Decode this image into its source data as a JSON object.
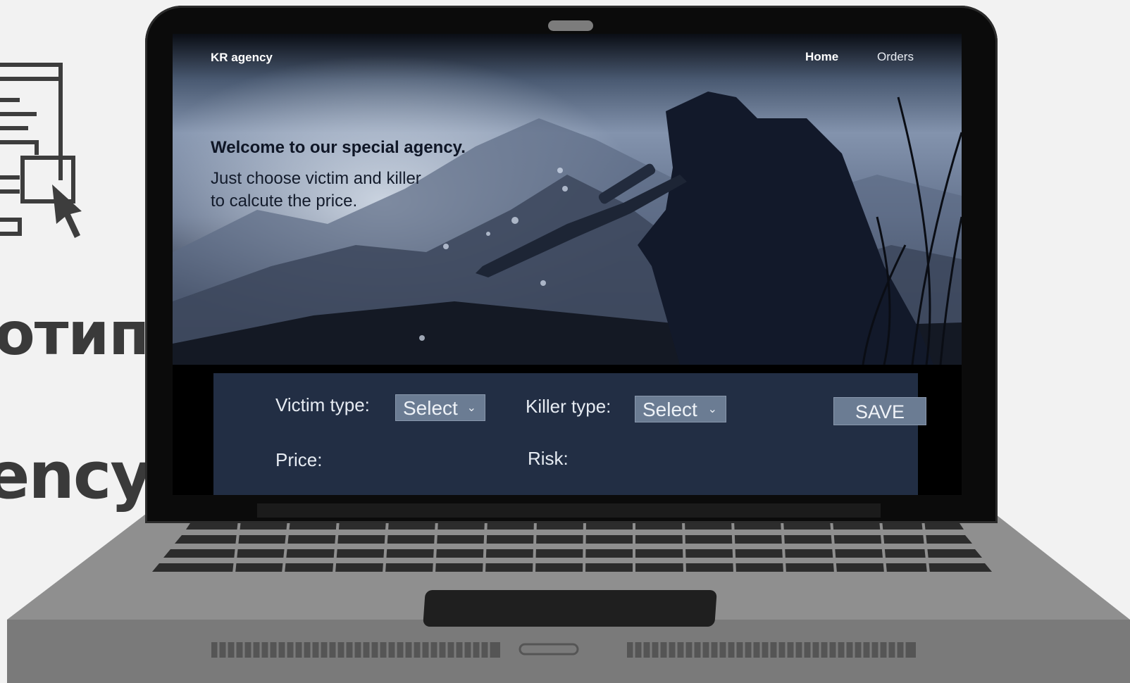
{
  "slide": {
    "word_top": "отип",
    "word_bottom": "ency"
  },
  "nav": {
    "brand": "KR agency",
    "links": [
      "Home",
      "Orders"
    ]
  },
  "hero": {
    "title": "Welcome to our special agency.",
    "subtitle_line1": "Just choose victim and killer",
    "subtitle_line2": "to calcute the price."
  },
  "form": {
    "victim_label": "Victim type:",
    "victim_select": "Select",
    "killer_label": "Killer type:",
    "killer_select": "Select",
    "save_label": "SAVE",
    "price_label": "Price:",
    "risk_label": "Risk:"
  },
  "colors": {
    "panel": "#222e44",
    "button": "#6b7c93",
    "laptop_body": "#8f8f8f",
    "background": "#f2f2f2"
  },
  "icons": {
    "slide_icon": "webpage-cursor-icon",
    "dropdown": "chevron-down-icon"
  }
}
